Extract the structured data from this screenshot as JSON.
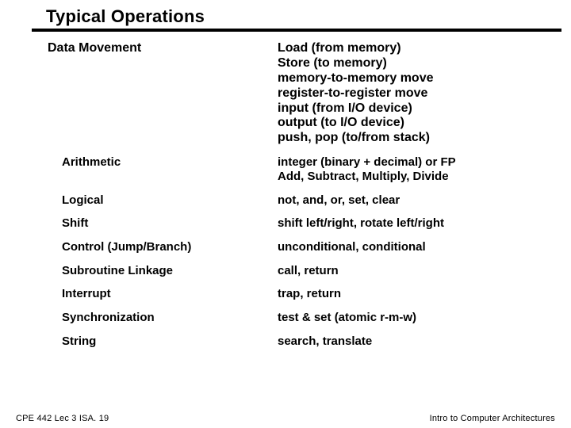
{
  "title": "Typical Operations",
  "rows": [
    {
      "category": "Data Movement",
      "details": [
        "Load (from memory)",
        "Store (to memory)",
        "memory-to-memory move",
        "register-to-register move",
        "input (from I/O device)",
        "output (to I/O device)",
        "push, pop (to/from stack)"
      ]
    },
    {
      "category": "Arithmetic",
      "details": [
        "integer (binary + decimal) or FP",
        "Add, Subtract, Multiply, Divide"
      ]
    },
    {
      "category": "Logical",
      "details": [
        "not, and, or, set, clear"
      ]
    },
    {
      "category": "Shift",
      "details": [
        "shift left/right, rotate left/right"
      ]
    },
    {
      "category": "Control (Jump/Branch)",
      "details": [
        "unconditional, conditional"
      ]
    },
    {
      "category": "Subroutine Linkage",
      "details": [
        "call, return"
      ]
    },
    {
      "category": "Interrupt",
      "details": [
        "trap, return"
      ]
    },
    {
      "category": "Synchronization",
      "details": [
        "test & set (atomic r-m-w)"
      ]
    },
    {
      "category": "String",
      "details": [
        "search, translate"
      ]
    }
  ],
  "footer": {
    "left": "CPE 442  Lec 3 ISA. 19",
    "right": "Intro to Computer Architectures"
  }
}
